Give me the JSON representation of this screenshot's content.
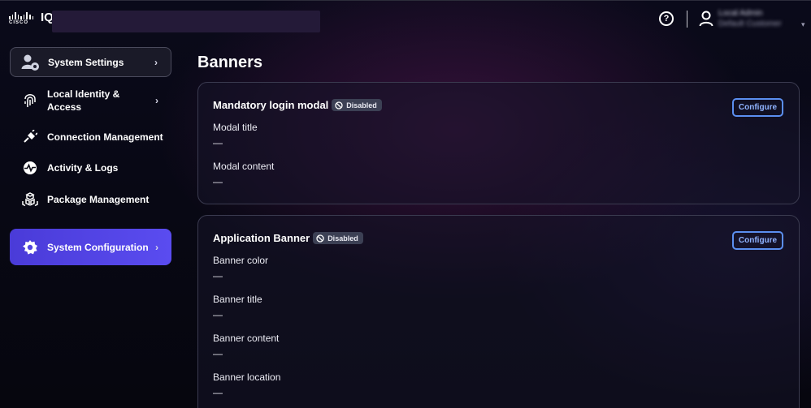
{
  "header": {
    "brand_word": "CISCO",
    "product": "IQ",
    "user_name": "Local Admin",
    "user_org": "Default Customer",
    "help_glyph": "?"
  },
  "sidebar": {
    "items": [
      {
        "label": "System Settings",
        "icon": "user-gear-icon",
        "active": false,
        "highlight": true
      },
      {
        "label": "Local Identity & Access",
        "icon": "fingerprint-icon"
      },
      {
        "label": "Connection Management",
        "icon": "plug-icon"
      },
      {
        "label": "Activity & Logs",
        "icon": "activity-pulse-icon"
      },
      {
        "label": "Package Management",
        "icon": "package-stack-icon"
      },
      {
        "label": "System Configuration",
        "icon": "gear-icon",
        "active": true
      }
    ]
  },
  "main": {
    "title": "Banners",
    "cards": [
      {
        "title": "Mandatory login modal",
        "status": "Disabled",
        "action": "Configure",
        "fields": [
          {
            "label": "Modal title",
            "value": "—"
          },
          {
            "label": "Modal content",
            "value": "—"
          }
        ]
      },
      {
        "title": "Application Banner",
        "status": "Disabled",
        "action": "Configure",
        "fields": [
          {
            "label": "Banner color",
            "value": "—"
          },
          {
            "label": "Banner title",
            "value": "—"
          },
          {
            "label": "Banner content",
            "value": "—"
          },
          {
            "label": "Banner location",
            "value": "—"
          }
        ]
      }
    ]
  },
  "colors": {
    "accent": "#5a4cf0",
    "button_border": "#5b8ff0",
    "badge_bg": "#3c4054"
  }
}
